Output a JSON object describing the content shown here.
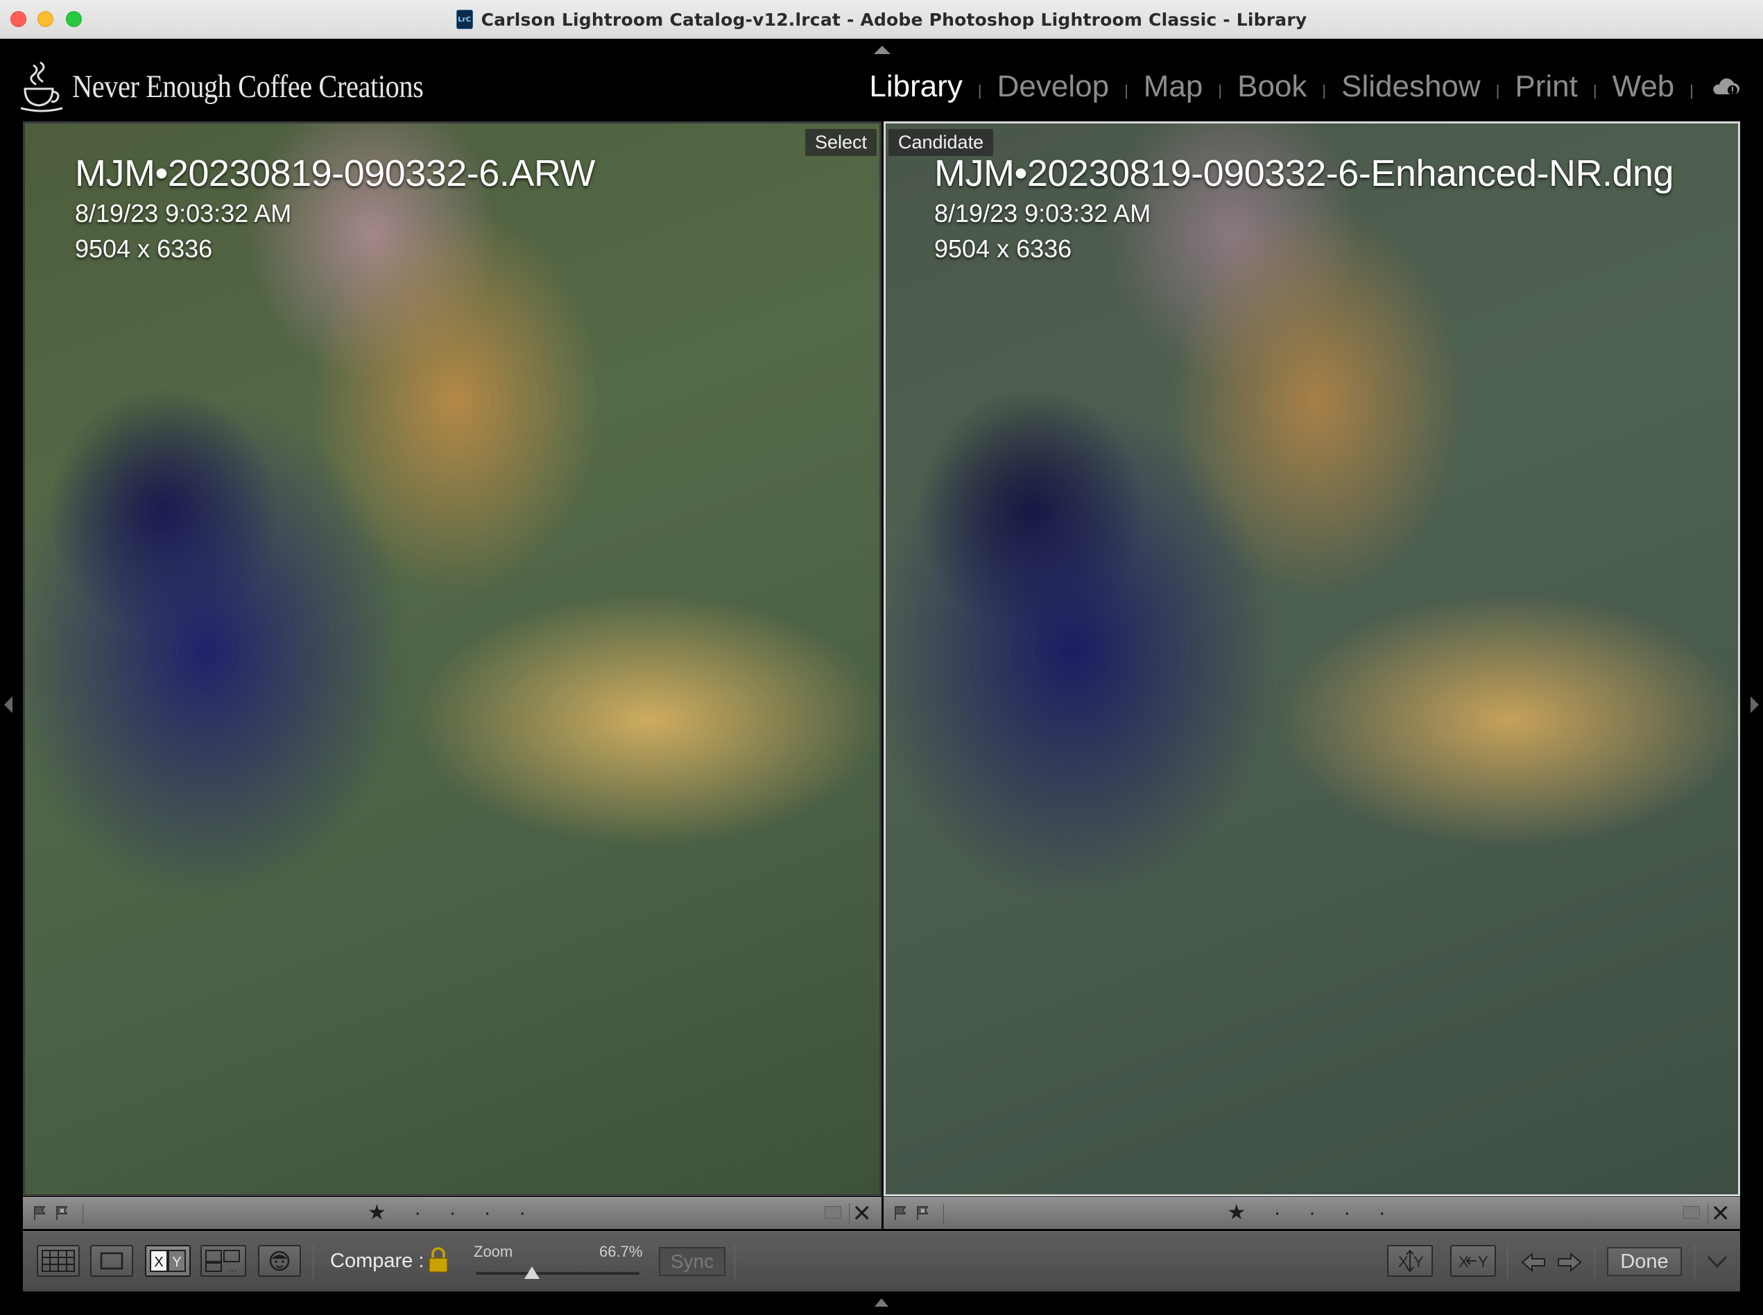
{
  "window": {
    "title": "Carlson Lightroom Catalog-v12.lrcat - Adobe Photoshop Lightroom Classic - Library",
    "app_icon_text": "LrC"
  },
  "identity_plate": {
    "text": "Never Enough Coffee Creations"
  },
  "modules": [
    {
      "label": "Library",
      "active": true
    },
    {
      "label": "Develop",
      "active": false
    },
    {
      "label": "Map",
      "active": false
    },
    {
      "label": "Book",
      "active": false
    },
    {
      "label": "Slideshow",
      "active": false
    },
    {
      "label": "Print",
      "active": false
    },
    {
      "label": "Web",
      "active": false
    }
  ],
  "module_separator": "|",
  "select_panel": {
    "tag": "Select",
    "filename": "MJM•20230819-090332-6.ARW",
    "datetime": "8/19/23 9:03:32 AM",
    "dimensions": "9504 x 6336",
    "rating_stars": 1
  },
  "candidate_panel": {
    "tag": "Candidate",
    "filename": "MJM•20230819-090332-6-Enhanced-NR.dng",
    "datetime": "8/19/23 9:03:32 AM",
    "dimensions": "9504 x 6336",
    "rating_stars": 1
  },
  "rating_display": "★ · · · ·",
  "close_glyph": "✕",
  "toolbar": {
    "compare_label": "Compare :",
    "zoom_label": "Zoom",
    "zoom_value": "66.7%",
    "zoom_level_percent": 66.7,
    "sync_label": "Sync",
    "done_label": "Done",
    "xy_label": "X|Y"
  },
  "colors": {
    "active_module": "#ffffff",
    "inactive_module": "#8c8c8c",
    "candidate_border": "#d8d8d8"
  }
}
